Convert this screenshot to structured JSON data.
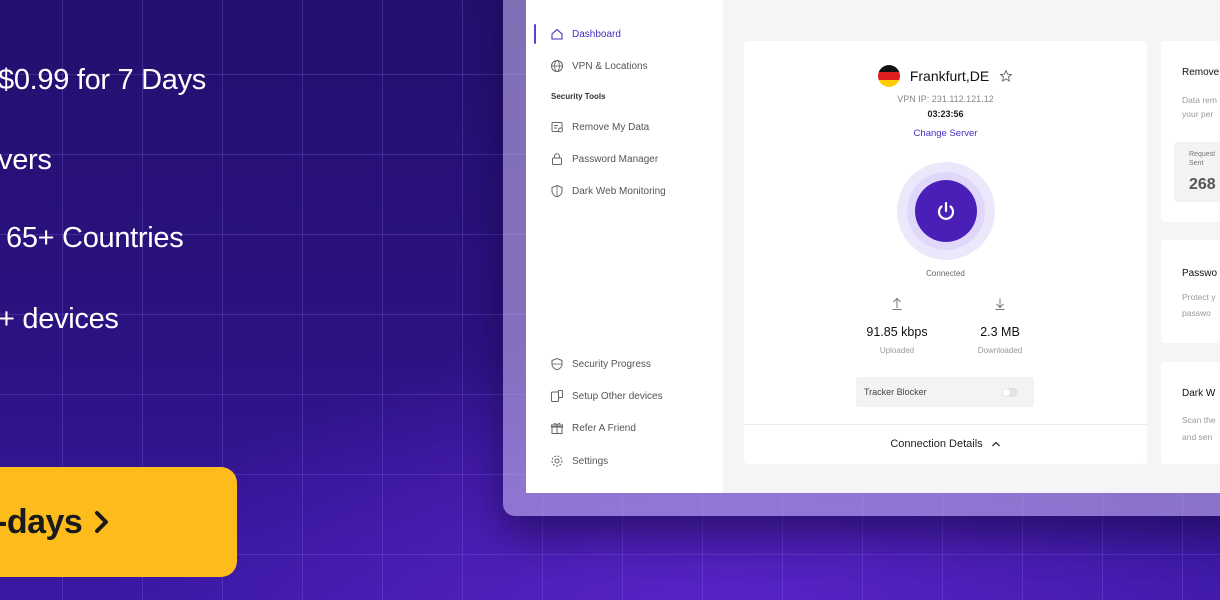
{
  "promo": {
    "features": [
      "$0.99 for 7 Days",
      "vers",
      "65+ Countries",
      "+ devices"
    ],
    "cta_label": "-days",
    "colors": {
      "cta": "#fdbb1c",
      "background": "#2a0f7a"
    }
  },
  "sidebar": {
    "nav": [
      {
        "label": "Dashboard",
        "icon": "home-icon",
        "active": true
      },
      {
        "label": "VPN & Locations",
        "icon": "globe-icon"
      }
    ],
    "section_title": "Security Tools",
    "tools": [
      {
        "label": "Remove My Data",
        "icon": "document-remove-icon"
      },
      {
        "label": "Password Manager",
        "icon": "lock-icon"
      },
      {
        "label": "Dark Web Monitoring",
        "icon": "shield-icon"
      }
    ],
    "bottom": [
      {
        "label": "Security Progress",
        "icon": "shield-progress-icon"
      },
      {
        "label": "Setup Other devices",
        "icon": "devices-icon"
      },
      {
        "label": "Refer A Friend",
        "icon": "gift-icon"
      },
      {
        "label": "Settings",
        "icon": "gear-icon"
      }
    ]
  },
  "vpn": {
    "location": "Frankfurt,DE",
    "ip": "VPN IP: 231.112.121.12",
    "timer": "03:23:56",
    "change_server": "Change Server",
    "status": "Connected",
    "upload": {
      "value": "91.85 kbps",
      "label": "Uploaded"
    },
    "download": {
      "value": "2.3 MB",
      "label": "Downloaded"
    },
    "tracker_blocker": {
      "label": "Tracker Blocker",
      "enabled": false
    },
    "connection_details": "Connection Details",
    "accent": "#4a1fb8"
  },
  "right_cards": {
    "remove": {
      "title": "Remove",
      "desc1": "Data rem",
      "desc2": "your per",
      "requests_label1": "Request",
      "requests_label2": "Sent",
      "requests_value": "268"
    },
    "password": {
      "title": "Passwo",
      "desc1": "Protect y",
      "desc2": "passwo"
    },
    "darkweb": {
      "title": "Dark W",
      "desc1": "Scan the",
      "desc2": "and sen"
    }
  }
}
